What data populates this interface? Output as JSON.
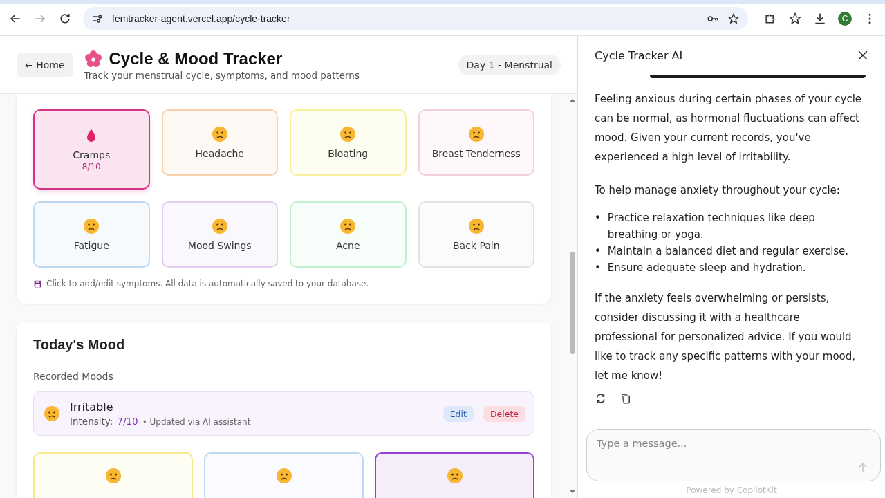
{
  "browser": {
    "url": "femtracker-agent.vercel.app/cycle-tracker",
    "profile_initial": "C"
  },
  "header": {
    "back_button": "← Home",
    "title": "Cycle & Mood Tracker",
    "subtitle": "Track your menstrual cycle, symptoms, and mood patterns",
    "phase_badge": "Day 1 - Menstrual"
  },
  "symptoms": [
    {
      "kind": "drop",
      "label": "Cramps",
      "intensity": "8/10",
      "selected": true,
      "color": "#d63384"
    },
    {
      "kind": "face",
      "label": "Headache",
      "selected": false,
      "color": "#f5d0a9"
    },
    {
      "kind": "face",
      "label": "Bloating",
      "selected": false,
      "color": "#f7ef9a"
    },
    {
      "kind": "face",
      "label": "Breast Tenderness",
      "selected": false,
      "color": "#f5cde0"
    },
    {
      "kind": "face",
      "label": "Fatigue",
      "selected": false,
      "color": "#bcd8f2"
    },
    {
      "kind": "face",
      "label": "Mood Swings",
      "selected": false,
      "color": "#e3cdf0"
    },
    {
      "kind": "face",
      "label": "Acne",
      "selected": false,
      "color": "#c4f0cf"
    },
    {
      "kind": "face",
      "label": "Back Pain",
      "selected": false,
      "color": "#e2e2e2"
    }
  ],
  "symptom_note": "Click to add/edit symptoms. All data is automatically saved to your database.",
  "mood": {
    "title": "Today's Mood",
    "recorded_label": "Recorded Moods",
    "recorded": [
      {
        "name": "Irritable",
        "intensity_label": "Intensity:",
        "intensity": "7/10",
        "note": "• Updated via AI assistant",
        "edit": "Edit",
        "delete": "Delete"
      }
    ],
    "options": [
      {
        "selected": false,
        "color": "#f5e98a"
      },
      {
        "selected": false,
        "color": "#bcd8f2"
      },
      {
        "selected": true,
        "color": "#9b3fd1"
      }
    ]
  },
  "chat": {
    "title": "Cycle Tracker AI",
    "paragraphs": [
      "Feeling anxious during certain phases of your cycle can be normal, as hormonal fluctuations can affect mood. Given your current records, you've experienced a high level of irritability.",
      "To help manage anxiety throughout your cycle:"
    ],
    "bullet_marker": "•",
    "bullets": [
      "Practice relaxation techniques like deep breathing or yoga.",
      "Maintain a balanced diet and regular exercise.",
      "Ensure adequate sleep and hydration."
    ],
    "closing": "If the anxiety feels overwhelming or persists, consider discussing it with a healthcare professional for personalized advice. If you would like to track any specific patterns with your mood, let me know!",
    "input_placeholder": "Type a message...",
    "footer": "Powered by CopilotKit"
  }
}
